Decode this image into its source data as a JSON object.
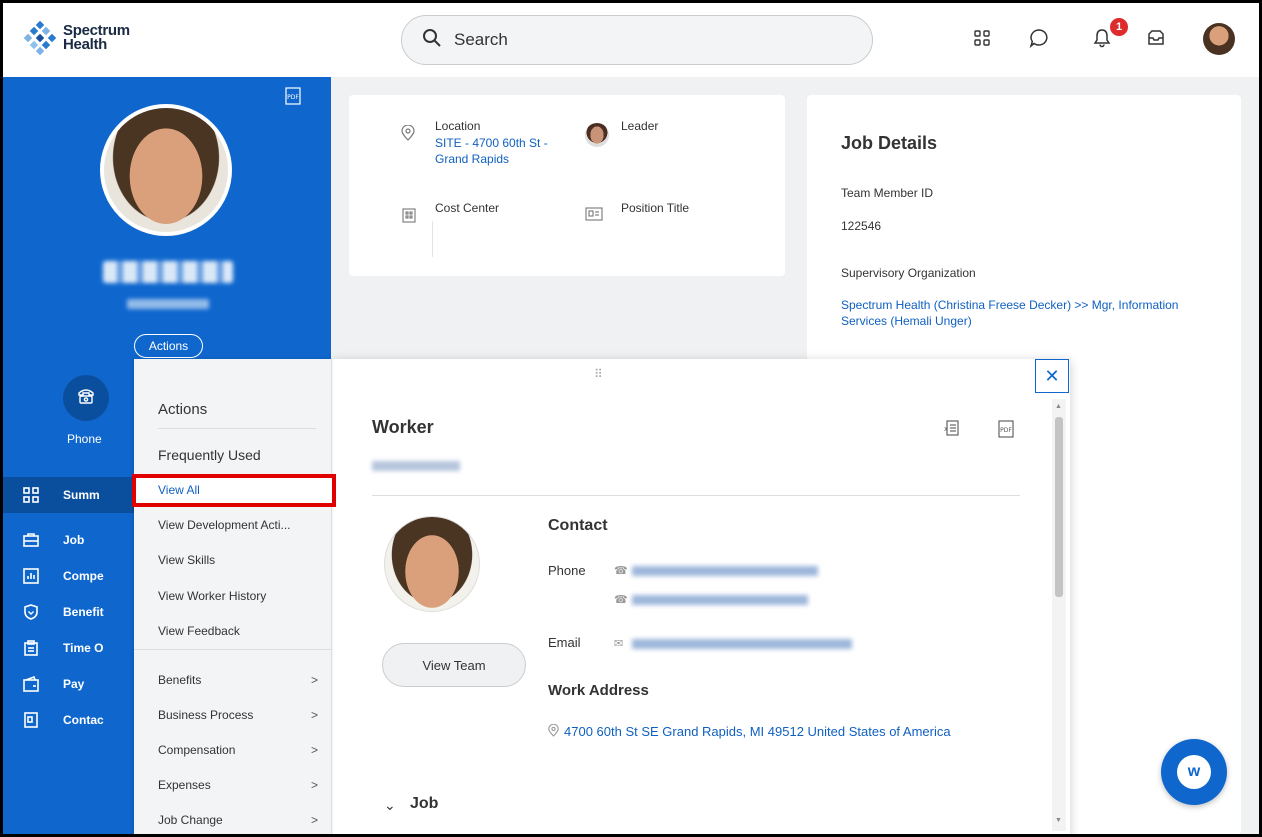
{
  "brand": {
    "name_line1": "Spectrum",
    "name_line2": "Health",
    "accent": "#0f67ce"
  },
  "search": {
    "label": "Search"
  },
  "notifications": {
    "count": "1"
  },
  "profile": {
    "actions_label": "Actions",
    "phone_label": "Phone"
  },
  "sidebar": {
    "items": [
      {
        "label": "Summ",
        "icon": "grid-icon"
      },
      {
        "label": "Job",
        "icon": "briefcase-icon"
      },
      {
        "label": "Compe",
        "icon": "chart-icon"
      },
      {
        "label": "Benefit",
        "icon": "shield-icon"
      },
      {
        "label": "Time O",
        "icon": "clipboard-icon"
      },
      {
        "label": "Pay",
        "icon": "wallet-icon"
      },
      {
        "label": "Contac",
        "icon": "contact-card-icon"
      }
    ]
  },
  "card_overview": {
    "location_label": "Location",
    "location_value_line1": "SITE - 4700 60th St -",
    "location_value_line2": "Grand Rapids",
    "leader_label": "Leader",
    "cost_center_label": "Cost Center",
    "position_title_label": "Position Title"
  },
  "job_details": {
    "title": "Job Details",
    "team_member_id_label": "Team Member ID",
    "team_member_id": "122546",
    "sup_org_label": "Supervisory Organization",
    "sup_org_line1": "Spectrum Health (Christina Freese Decker) >> Mgr, Information",
    "sup_org_line2": "Services (Hemali Unger)"
  },
  "actions_menu": {
    "title": "Actions",
    "section": "Frequently Used",
    "frequent": [
      "View All",
      "View Development Acti...",
      "View Skills",
      "View Worker History",
      "View Feedback"
    ],
    "categories": [
      "Benefits",
      "Business Process",
      "Compensation",
      "Expenses",
      "Job Change"
    ]
  },
  "worker_popup": {
    "title": "Worker",
    "contact_heading": "Contact",
    "phone_label": "Phone",
    "email_label": "Email",
    "view_team": "View Team",
    "work_address_heading": "Work Address",
    "work_address": "4700 60th St SE Grand Rapids, MI 49512 United States of America",
    "job_section": "Job"
  }
}
